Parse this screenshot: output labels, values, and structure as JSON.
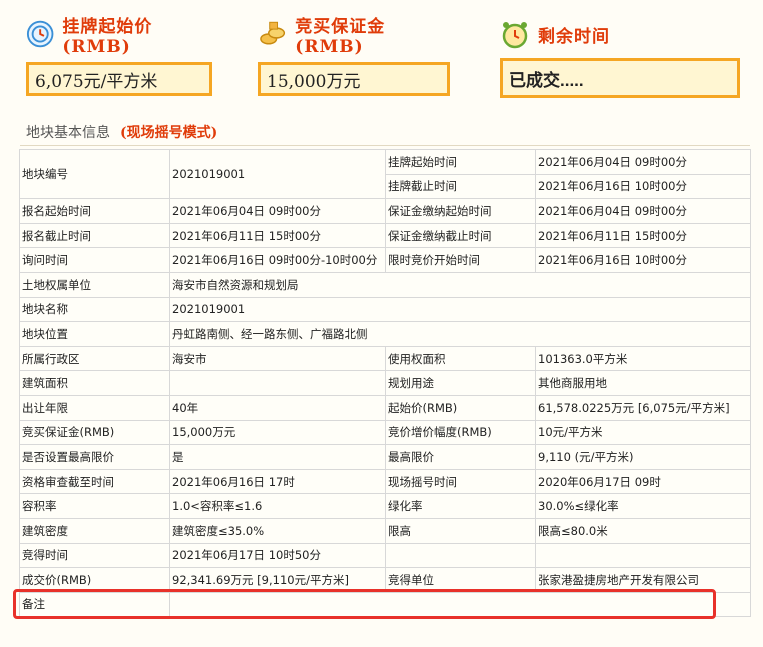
{
  "summary": {
    "start_price": {
      "label": "挂牌起始价(RMB)",
      "value": "6,075元/平方米"
    },
    "deposit": {
      "label": "竞买保证金(RMB)",
      "value": "15,000万元"
    },
    "remaining": {
      "label": "剩余时间",
      "value": "已成交....."
    }
  },
  "section": {
    "title": "地块基本信息",
    "mode": "(现场摇号模式)"
  },
  "table": {
    "plot_no_label": "地块编号",
    "plot_no": "2021019001",
    "list_start_label": "挂牌起始时间",
    "list_start": "2021年06月04日 09时00分",
    "list_end_label": "挂牌截止时间",
    "list_end": "2021年06月16日 10时00分",
    "rows": [
      [
        "报名起始时间",
        "2021年06月04日 09时00分",
        "保证金缴纳起始时间",
        "2021年06月04日 09时00分"
      ],
      [
        "报名截止时间",
        "2021年06月11日 15时00分",
        "保证金缴纳截止时间",
        "2021年06月11日 15时00分"
      ],
      [
        "询问时间",
        "2021年06月16日 09时00分-10时00分",
        "限时竞价开始时间",
        "2021年06月16日 10时00分"
      ]
    ],
    "wide_rows": [
      [
        "土地权属单位",
        "海安市自然资源和规划局"
      ],
      [
        "地块名称",
        "2021019001"
      ],
      [
        "地块位置",
        "丹虹路南侧、经一路东侧、广福路北侧"
      ]
    ],
    "rows2": [
      [
        "所属行政区",
        "海安市",
        "使用权面积",
        "101363.0平方米"
      ],
      [
        "建筑面积",
        "",
        "规划用途",
        "其他商服用地"
      ],
      [
        "出让年限",
        "40年",
        "起始价(RMB)",
        "61,578.0225万元 [6,075元/平方米]"
      ],
      [
        "竞买保证金(RMB)",
        "15,000万元",
        "竞价增价幅度(RMB)",
        "10元/平方米"
      ],
      [
        "是否设置最高限价",
        "是",
        "最高限价",
        "9,110 (元/平方米)"
      ],
      [
        "资格审查截至时间",
        "2021年06月16日 17时",
        "现场摇号时间",
        "2020年06月17日 09时"
      ],
      [
        "容积率",
        "1.0<容积率≤1.6",
        "绿化率",
        "30.0%≤绿化率"
      ],
      [
        "建筑密度",
        "建筑密度≤35.0%",
        "限高",
        "限高≤80.0米"
      ],
      [
        "竞得时间",
        "2021年06月17日 10时50分",
        "",
        ""
      ],
      [
        "成交价(RMB)",
        "92,341.69万元 [9,110元/平方米]",
        "竞得单位",
        "张家港盈捷房地产开发有限公司"
      ]
    ],
    "note_label": "备注",
    "note": ""
  }
}
